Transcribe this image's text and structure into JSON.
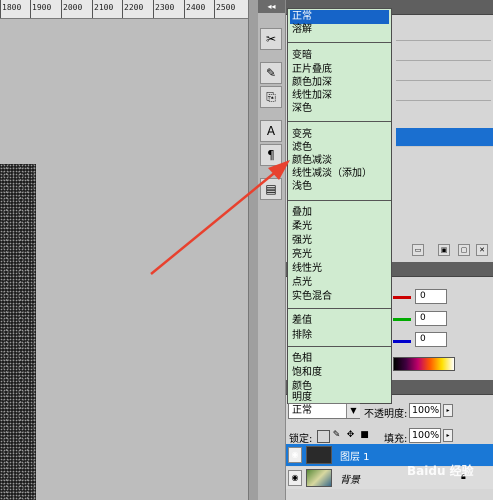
{
  "ruler": {
    "ticks": [
      "1800",
      "1900",
      "2000",
      "2100",
      "2200",
      "2300",
      "2400",
      "2500"
    ]
  },
  "blend_menu": {
    "groups": [
      [
        "正常",
        "溶解"
      ],
      [
        "变暗",
        "正片叠底",
        "颜色加深",
        "线性加深",
        "深色"
      ],
      [
        "变亮",
        "滤色",
        "颜色减淡",
        "线性减淡（添加）",
        "浅色"
      ],
      [
        "叠加",
        "柔光",
        "强光",
        "亮光",
        "线性光",
        "点光",
        "实色混合"
      ],
      [
        "差值",
        "排除"
      ],
      [
        "色相",
        "饱和度",
        "颜色",
        "明度"
      ]
    ],
    "selected": "正常"
  },
  "color_panel": {
    "r_value": "0",
    "g_value": "0",
    "b_value": "0",
    "colors": {
      "red": "#cc0000",
      "green": "#00aa00",
      "blue": "#0000cc"
    }
  },
  "layers_panel": {
    "blend_mode": "正常",
    "opacity_label": "不透明度:",
    "opacity_value": "100%",
    "lock_label": "锁定:",
    "fill_label": "填充:",
    "fill_value": "100%",
    "layers": [
      {
        "name": "图层 1",
        "selected": true
      },
      {
        "name": "背景",
        "selected": false
      }
    ]
  },
  "watermark": {
    "text": "Baidu 经验"
  },
  "accent": {
    "selection": "#1664c8",
    "menu_bg": "#d0ebd0",
    "arrow": "#e8412e"
  }
}
